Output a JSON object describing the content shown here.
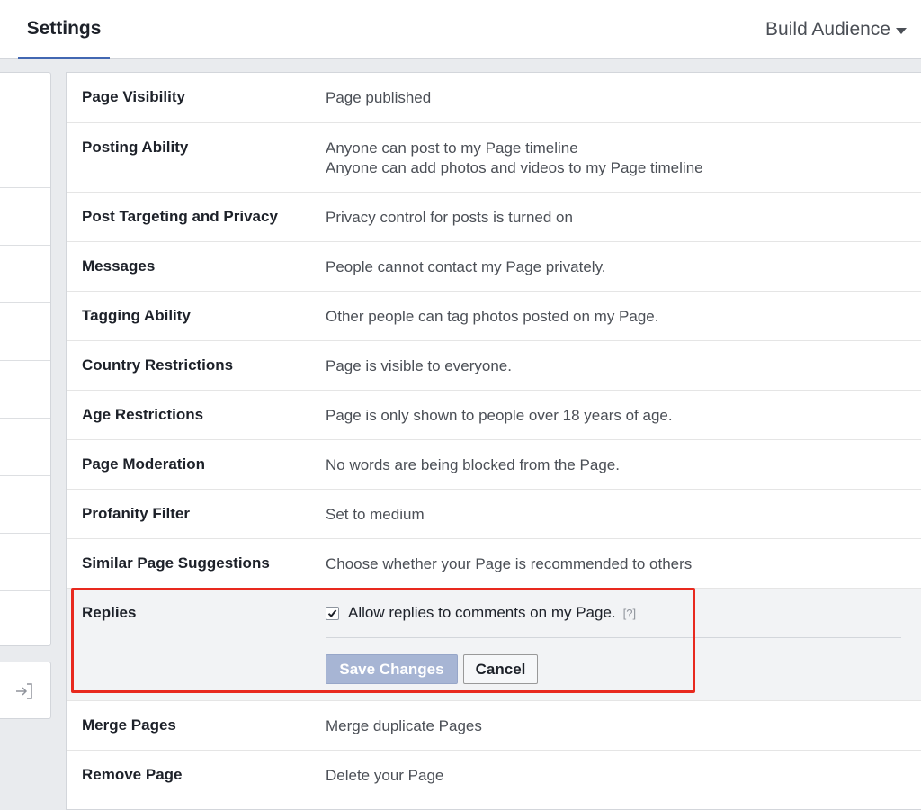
{
  "header": {
    "tab_settings": "Settings",
    "build_audience": "Build Audience",
    "build_audience_icon": "caret-down-icon"
  },
  "sidebar": {
    "items": 10,
    "exit_icon": "exit-arrow-icon"
  },
  "settings": {
    "page_visibility": {
      "label": "Page Visibility",
      "value": "Page published"
    },
    "posting_ability": {
      "label": "Posting Ability",
      "line1": "Anyone can post to my Page timeline",
      "line2": "Anyone can add photos and videos to my Page timeline"
    },
    "post_targeting": {
      "label": "Post Targeting and Privacy",
      "value": "Privacy control for posts is turned on"
    },
    "messages": {
      "label": "Messages",
      "value": "People cannot contact my Page privately."
    },
    "tagging": {
      "label": "Tagging Ability",
      "value": "Other people can tag photos posted on my Page."
    },
    "country": {
      "label": "Country Restrictions",
      "value": "Page is visible to everyone."
    },
    "age": {
      "label": "Age Restrictions",
      "value": "Page is only shown to people over 18 years of age."
    },
    "moderation": {
      "label": "Page Moderation",
      "value": "No words are being blocked from the Page."
    },
    "profanity": {
      "label": "Profanity Filter",
      "value": "Set to medium"
    },
    "similar": {
      "label": "Similar Page Suggestions",
      "value": "Choose whether your Page is recommended to others"
    },
    "replies": {
      "label": "Replies",
      "checkbox_label": "Allow replies to comments on my Page.",
      "checked": true,
      "help": "[?]",
      "save": "Save Changes",
      "cancel": "Cancel"
    },
    "merge": {
      "label": "Merge Pages",
      "value": "Merge duplicate Pages"
    },
    "remove": {
      "label": "Remove Page",
      "value": "Delete your Page"
    }
  },
  "colors": {
    "accent": "#4267b2",
    "highlight": "#e8291e",
    "save_disabled": "#a7b5d4"
  }
}
